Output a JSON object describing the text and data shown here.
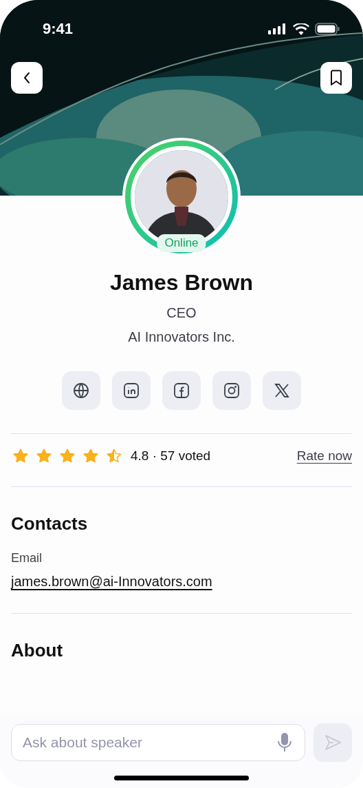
{
  "status_bar": {
    "time": "9:41"
  },
  "profile": {
    "status": "Online",
    "online": true,
    "name": "James Brown",
    "role": "CEO",
    "company": "AI Innovators Inc."
  },
  "social_links": [
    {
      "kind": "website"
    },
    {
      "kind": "linkedin"
    },
    {
      "kind": "facebook"
    },
    {
      "kind": "instagram"
    },
    {
      "kind": "x"
    }
  ],
  "rating": {
    "stars": 4.5,
    "summary": "4.8 · 57 voted",
    "action": "Rate now"
  },
  "contacts": {
    "title": "Contacts",
    "email_label": "Email",
    "email": "james.brown@ai-Innovators.com"
  },
  "about": {
    "title": "About"
  },
  "ask": {
    "placeholder": "Ask about speaker"
  }
}
